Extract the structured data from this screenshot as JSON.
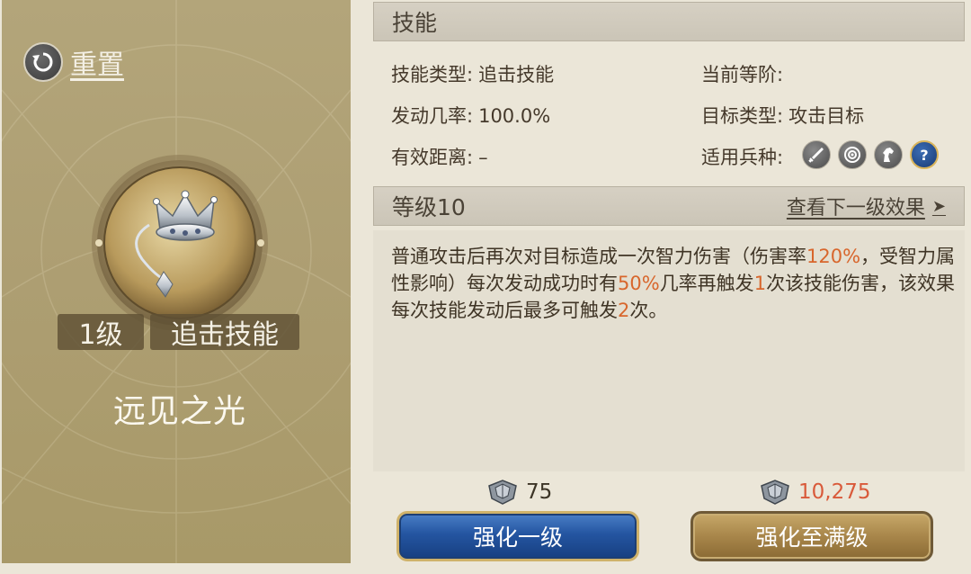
{
  "left": {
    "reset_label": "重置",
    "level_badge": "1级",
    "type_badge": "追击技能",
    "skill_name": "远见之光"
  },
  "skill_section": {
    "header": "技能",
    "rows": [
      {
        "label": "技能类型:",
        "value": "追击技能"
      },
      {
        "label": "发动几率:",
        "value": "100.0%"
      },
      {
        "label": "有效距离:",
        "value": "–"
      },
      {
        "label": "当前等阶:",
        "value": ""
      },
      {
        "label": "目标类型:",
        "value": "攻击目标"
      },
      {
        "label": "适用兵种:",
        "value": ""
      }
    ],
    "troop_icons": [
      "sword-icon",
      "bow-target-icon",
      "horse-icon",
      "question-icon"
    ]
  },
  "level_section": {
    "header": "等级10",
    "next_link": "查看下一级效果",
    "desc": {
      "p1": "普通攻击后再次对目标造成一次智力伤害（伤害率",
      "h1": "120%",
      "p2": "，受智力属性影响）每次发动成功时有",
      "h2": "50%",
      "p3": "几率再触发",
      "h3": "1",
      "p4": "次该技能伤害，该效果每次技能发动后最多可触发",
      "h4": "2",
      "p5": "次。"
    }
  },
  "costs": {
    "one": "75",
    "max": "10,275"
  },
  "buttons": {
    "upgrade_one": "强化一级",
    "upgrade_max": "强化至满级"
  },
  "colors": {
    "highlight": "#d8662c",
    "cost_insufficient": "#d95a3a",
    "blue_button": "#2455a1",
    "gold_button": "#a8864a"
  }
}
